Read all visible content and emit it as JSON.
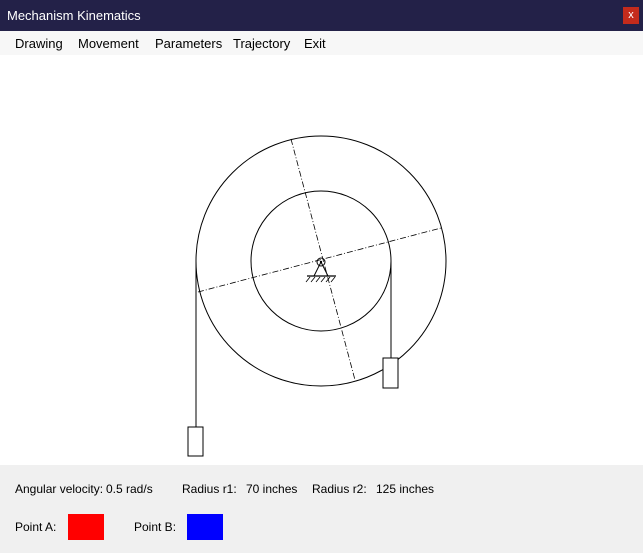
{
  "window": {
    "title": "Mechanism Kinematics",
    "close_label": "x"
  },
  "menu": {
    "items": [
      "Drawing",
      "Movement",
      "Parameters",
      "Trajectory",
      "Exit"
    ]
  },
  "params": {
    "angular_velocity_label": "Angular velocity:",
    "angular_velocity_value": "0.5 rad/s",
    "radius_r1_label": "Radius r1:",
    "radius_r1_value": "70 inches",
    "radius_r2_label": "Radius r2:",
    "radius_r2_value": "125 inches"
  },
  "points": {
    "point_a_label": "Point A:",
    "point_a_color": "#ff0000",
    "point_b_label": "Point B:",
    "point_b_color": "#0000ff"
  }
}
